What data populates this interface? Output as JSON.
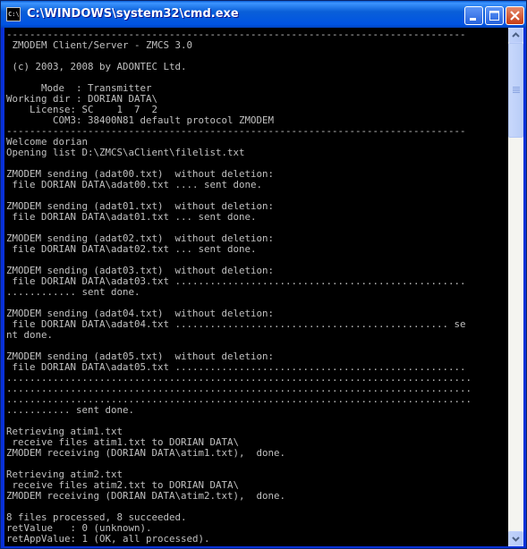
{
  "window": {
    "title": "C:\\WINDOWS\\system32\\cmd.exe",
    "icon_text": "C:\\",
    "controls": [
      "minimize-icon",
      "maximize-icon",
      "close-icon"
    ]
  },
  "console": {
    "lines": [
      "-------------------------------------------------------------------------------",
      " ZMODEM Client/Server - ZMCS 3.0",
      "",
      " (c) 2003, 2008 by ADONTEC Ltd.",
      "",
      "      Mode  : Transmitter",
      "Working dir : DORIAN DATA\\",
      "    License: SC    1  7  2",
      "        COM3: 38400N81 default protocol ZMODEM",
      "-------------------------------------------------------------------------------",
      "Welcome dorian",
      "Opening list D:\\ZMCS\\aClient\\filelist.txt",
      "",
      "ZMODEM sending (adat00.txt)  without deletion:",
      " file DORIAN DATA\\adat00.txt .... sent done.",
      "",
      "ZMODEM sending (adat01.txt)  without deletion:",
      " file DORIAN DATA\\adat01.txt ... sent done.",
      "",
      "ZMODEM sending (adat02.txt)  without deletion:",
      " file DORIAN DATA\\adat02.txt ... sent done.",
      "",
      "ZMODEM sending (adat03.txt)  without deletion:",
      " file DORIAN DATA\\adat03.txt ..................................................",
      "............ sent done.",
      "",
      "ZMODEM sending (adat04.txt)  without deletion:",
      " file DORIAN DATA\\adat04.txt ............................................... se",
      "nt done.",
      "",
      "ZMODEM sending (adat05.txt)  without deletion:",
      " file DORIAN DATA\\adat05.txt ..................................................",
      "................................................................................",
      "................................................................................",
      "................................................................................",
      "........... sent done.",
      "",
      "Retrieving atim1.txt",
      " receive files atim1.txt to DORIAN DATA\\",
      "ZMODEM receiving (DORIAN DATA\\atim1.txt),  done.",
      "",
      "Retrieving atim2.txt",
      " receive files atim2.txt to DORIAN DATA\\",
      "ZMODEM receiving (DORIAN DATA\\atim2.txt),  done.",
      "",
      "8 files processed, 8 succeeded.",
      "retValue   : 0 (unknown).",
      "retAppValue: 1 (OK, all processed)."
    ]
  },
  "colors": {
    "console_bg": "#000000",
    "console_fg": "#c0c0c0",
    "titlebar": "#0054e3"
  }
}
